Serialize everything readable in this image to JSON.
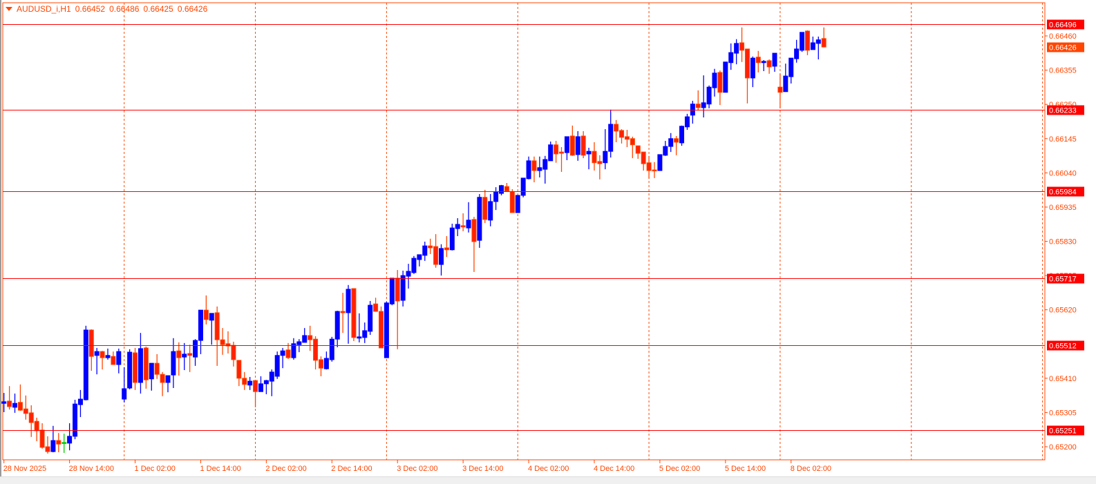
{
  "header": {
    "symbol": "AUDUSD_i,H1",
    "open": "0.66452",
    "high": "0.66486",
    "low": "0.66425",
    "close": "0.66426"
  },
  "colors": {
    "bull": "#0000ff",
    "bear_fill": "#ff2200",
    "bear_outline": "#ff4500",
    "doji_neutral": "#00cc00",
    "level_line": "#ff0000",
    "grid": "#ff4500",
    "axis_text": "#ff4500",
    "ask_label": "#ff4500"
  },
  "chart_data": {
    "type": "candlestick",
    "timeframe": "H1",
    "ylim": [
      0.65165,
      0.666
    ],
    "grid": "vertical dashed, daily",
    "y_ticks": [
      "0.66460",
      "0.66355",
      "0.66250",
      "0.66145",
      "0.66040",
      "0.65935",
      "0.65830",
      "0.65725",
      "0.65620",
      "0.65410",
      "0.65305",
      "0.65200"
    ],
    "x_tick_labels": [
      "28 Nov 2025",
      "28 Nov 14:00",
      "1 Dec 02:00",
      "1 Dec 14:00",
      "2 Dec 02:00",
      "2 Dec 14:00",
      "3 Dec 02:00",
      "3 Dec 14:00",
      "4 Dec 02:00",
      "4 Dec 14:00",
      "5 Dec 02:00",
      "5 Dec 14:00",
      "8 Dec 02:00"
    ],
    "levels": [
      "0.66496",
      "0.66233",
      "0.65984",
      "0.65717",
      "0.65512",
      "0.65251"
    ],
    "current_price": "0.66426",
    "ohlc": [
      [
        0.65333,
        0.65365,
        0.65306,
        0.65338
      ],
      [
        0.6534,
        0.65386,
        0.65314,
        0.65323
      ],
      [
        0.65321,
        0.65363,
        0.65304,
        0.65333
      ],
      [
        0.65336,
        0.65391,
        0.6531,
        0.65312
      ],
      [
        0.65316,
        0.65357,
        0.65283,
        0.65302
      ],
      [
        0.65304,
        0.65327,
        0.6523,
        0.65274
      ],
      [
        0.65278,
        0.65289,
        0.65217,
        0.65249
      ],
      [
        0.65251,
        0.65272,
        0.65194,
        0.65198
      ],
      [
        0.652,
        0.65232,
        0.65179,
        0.65185
      ],
      [
        0.65185,
        0.65264,
        0.65183,
        0.65219
      ],
      [
        0.65219,
        0.65242,
        0.65183,
        0.65208
      ],
      [
        0.65213,
        0.6524,
        0.65181,
        0.65213
      ],
      [
        0.65211,
        0.65272,
        0.65189,
        0.65232
      ],
      [
        0.65232,
        0.65344,
        0.65223,
        0.65331
      ],
      [
        0.65329,
        0.65374,
        0.65291,
        0.65346
      ],
      [
        0.65344,
        0.65571,
        0.65342,
        0.65558
      ],
      [
        0.65558,
        0.6556,
        0.65433,
        0.65477
      ],
      [
        0.6548,
        0.65503,
        0.65422,
        0.65492
      ],
      [
        0.65492,
        0.65494,
        0.65437,
        0.65473
      ],
      [
        0.65473,
        0.65501,
        0.65467,
        0.6548
      ],
      [
        0.65477,
        0.65492,
        0.65452,
        0.65452
      ],
      [
        0.65452,
        0.65501,
        0.65425,
        0.65492
      ],
      [
        0.65346,
        0.65444,
        0.65336,
        0.65378
      ],
      [
        0.6538,
        0.65499,
        0.65376,
        0.6549
      ],
      [
        0.65488,
        0.65503,
        0.65374,
        0.65397
      ],
      [
        0.65397,
        0.65549,
        0.65363,
        0.65501
      ],
      [
        0.65503,
        0.65507,
        0.65378,
        0.65405
      ],
      [
        0.65408,
        0.65456,
        0.65372,
        0.65456
      ],
      [
        0.65456,
        0.65484,
        0.65408,
        0.65422
      ],
      [
        0.65422,
        0.65429,
        0.65355,
        0.65397
      ],
      [
        0.65397,
        0.65418,
        0.65367,
        0.65418
      ],
      [
        0.6542,
        0.65533,
        0.6538,
        0.65492
      ],
      [
        0.65494,
        0.6552,
        0.65418,
        0.65473
      ],
      [
        0.65475,
        0.65518,
        0.65435,
        0.65484
      ],
      [
        0.65486,
        0.65513,
        0.65429,
        0.6548
      ],
      [
        0.65475,
        0.6553,
        0.65448,
        0.65526
      ],
      [
        0.65526,
        0.65619,
        0.65484,
        0.65619
      ],
      [
        0.65619,
        0.65664,
        0.65575,
        0.6559
      ],
      [
        0.65588,
        0.65609,
        0.65513,
        0.65609
      ],
      [
        0.65611,
        0.6563,
        0.65448,
        0.65528
      ],
      [
        0.65528,
        0.65564,
        0.65482,
        0.65513
      ],
      [
        0.65516,
        0.65554,
        0.65486,
        0.65509
      ],
      [
        0.65511,
        0.65522,
        0.65446,
        0.65467
      ],
      [
        0.65465,
        0.65465,
        0.65386,
        0.6541
      ],
      [
        0.6541,
        0.65429,
        0.65374,
        0.65391
      ],
      [
        0.65389,
        0.65414,
        0.65374,
        0.65401
      ],
      [
        0.65403,
        0.65403,
        0.65321,
        0.65369
      ],
      [
        0.65369,
        0.65416,
        0.65369,
        0.65393
      ],
      [
        0.65393,
        0.65405,
        0.65361,
        0.65403
      ],
      [
        0.65401,
        0.65437,
        0.65355,
        0.65429
      ],
      [
        0.65416,
        0.65492,
        0.65408,
        0.6548
      ],
      [
        0.6548,
        0.65503,
        0.65441,
        0.65494
      ],
      [
        0.65497,
        0.65518,
        0.65469,
        0.65473
      ],
      [
        0.65473,
        0.65533,
        0.65467,
        0.65516
      ],
      [
        0.65513,
        0.6553,
        0.6549,
        0.65522
      ],
      [
        0.6552,
        0.65564,
        0.6552,
        0.65541
      ],
      [
        0.65541,
        0.65571,
        0.65494,
        0.65528
      ],
      [
        0.6553,
        0.65539,
        0.65437,
        0.65465
      ],
      [
        0.65467,
        0.65477,
        0.65416,
        0.65441
      ],
      [
        0.65439,
        0.65492,
        0.65437,
        0.65471
      ],
      [
        0.65467,
        0.65537,
        0.65461,
        0.6553
      ],
      [
        0.6553,
        0.65617,
        0.65505,
        0.65615
      ],
      [
        0.65615,
        0.65672,
        0.65549,
        0.65611
      ],
      [
        0.65611,
        0.65696,
        0.65516,
        0.65683
      ],
      [
        0.65685,
        0.65685,
        0.65524,
        0.65535
      ],
      [
        0.65533,
        0.65609,
        0.6552,
        0.65537
      ],
      [
        0.65535,
        0.65581,
        0.65518,
        0.65556
      ],
      [
        0.65554,
        0.65647,
        0.65543,
        0.65634
      ],
      [
        0.65638,
        0.65657,
        0.65615,
        0.65615
      ],
      [
        0.65615,
        0.6563,
        0.65503,
        0.65503
      ],
      [
        0.65473,
        0.65645,
        0.65473,
        0.65641
      ],
      [
        0.65638,
        0.65717,
        0.65634,
        0.65717
      ],
      [
        0.65717,
        0.65742,
        0.65499,
        0.65647
      ],
      [
        0.65649,
        0.6574,
        0.6563,
        0.65725
      ],
      [
        0.65723,
        0.65761,
        0.65685,
        0.65738
      ],
      [
        0.65734,
        0.65785,
        0.6573,
        0.65778
      ],
      [
        0.65774,
        0.65789,
        0.65753,
        0.65789
      ],
      [
        0.65787,
        0.65829,
        0.6577,
        0.65816
      ],
      [
        0.65816,
        0.65838,
        0.65791,
        0.6581
      ],
      [
        0.65814,
        0.65852,
        0.65749,
        0.65759
      ],
      [
        0.65759,
        0.65821,
        0.65725,
        0.65808
      ],
      [
        0.6581,
        0.65846,
        0.65782,
        0.65804
      ],
      [
        0.65804,
        0.65884,
        0.65802,
        0.65871
      ],
      [
        0.65869,
        0.65901,
        0.65846,
        0.65882
      ],
      [
        0.65878,
        0.65916,
        0.65861,
        0.65874
      ],
      [
        0.65871,
        0.6595,
        0.65857,
        0.65895
      ],
      [
        0.65897,
        0.65905,
        0.65736,
        0.65829
      ],
      [
        0.65833,
        0.65975,
        0.6581,
        0.65965
      ],
      [
        0.65965,
        0.65988,
        0.65886,
        0.65897
      ],
      [
        0.65895,
        0.65975,
        0.65876,
        0.65952
      ],
      [
        0.65952,
        0.65996,
        0.65926,
        0.65982
      ],
      [
        0.65977,
        0.66003,
        0.65971,
        0.66001
      ],
      [
        0.65998,
        0.66009,
        0.65982,
        0.65984
      ],
      [
        0.65982,
        0.6599,
        0.65918,
        0.65918
      ],
      [
        0.65918,
        0.65971,
        0.65918,
        0.65971
      ],
      [
        0.65971,
        0.66024,
        0.65965,
        0.66024
      ],
      [
        0.66022,
        0.6609,
        0.6602,
        0.66077
      ],
      [
        0.66077,
        0.6609,
        0.66011,
        0.66047
      ],
      [
        0.66047,
        0.6609,
        0.66026,
        0.66056
      ],
      [
        0.66051,
        0.66092,
        0.66007,
        0.66081
      ],
      [
        0.66077,
        0.66136,
        0.66077,
        0.66126
      ],
      [
        0.66126,
        0.66138,
        0.66071,
        0.66098
      ],
      [
        0.66104,
        0.66119,
        0.66043,
        0.661
      ],
      [
        0.66102,
        0.66151,
        0.66079,
        0.66151
      ],
      [
        0.66153,
        0.66185,
        0.66092,
        0.66094
      ],
      [
        0.66096,
        0.66168,
        0.66077,
        0.66151
      ],
      [
        0.66153,
        0.66168,
        0.66085,
        0.66094
      ],
      [
        0.66098,
        0.66117,
        0.66051,
        0.66106
      ],
      [
        0.66106,
        0.66134,
        0.66047,
        0.66071
      ],
      [
        0.66075,
        0.66094,
        0.6602,
        0.66068
      ],
      [
        0.66071,
        0.66174,
        0.66051,
        0.66106
      ],
      [
        0.66106,
        0.66234,
        0.66087,
        0.66189
      ],
      [
        0.66189,
        0.66202,
        0.66134,
        0.66168
      ],
      [
        0.6617,
        0.66174,
        0.6613,
        0.66149
      ],
      [
        0.66151,
        0.66172,
        0.66119,
        0.66143
      ],
      [
        0.66145,
        0.66151,
        0.66085,
        0.66126
      ],
      [
        0.66123,
        0.66123,
        0.66083,
        0.661
      ],
      [
        0.66104,
        0.66104,
        0.66047,
        0.66068
      ],
      [
        0.66071,
        0.66092,
        0.66022,
        0.66047
      ],
      [
        0.66049,
        0.66073,
        0.66024,
        0.66047
      ],
      [
        0.66047,
        0.66096,
        0.66047,
        0.66096
      ],
      [
        0.66094,
        0.66138,
        0.66092,
        0.66121
      ],
      [
        0.66121,
        0.66162,
        0.66104,
        0.66145
      ],
      [
        0.66145,
        0.66153,
        0.66094,
        0.66134
      ],
      [
        0.66132,
        0.66185,
        0.66123,
        0.66183
      ],
      [
        0.66181,
        0.66221,
        0.66172,
        0.66212
      ],
      [
        0.66217,
        0.66261,
        0.66191,
        0.66251
      ],
      [
        0.66251,
        0.66293,
        0.66231,
        0.6624
      ],
      [
        0.6624,
        0.66339,
        0.6621,
        0.66255
      ],
      [
        0.66251,
        0.66308,
        0.66238,
        0.66303
      ],
      [
        0.66301,
        0.66359,
        0.66274,
        0.66346
      ],
      [
        0.66348,
        0.66354,
        0.66248,
        0.66287
      ],
      [
        0.66287,
        0.6638,
        0.66287,
        0.6638
      ],
      [
        0.66378,
        0.66437,
        0.66356,
        0.66409
      ],
      [
        0.66407,
        0.6645,
        0.66373,
        0.66437
      ],
      [
        0.66439,
        0.66486,
        0.6638,
        0.66416
      ],
      [
        0.6642,
        0.6642,
        0.66253,
        0.66331
      ],
      [
        0.66331,
        0.66397,
        0.66303,
        0.66392
      ],
      [
        0.66395,
        0.66414,
        0.66348,
        0.66378
      ],
      [
        0.66378,
        0.66386,
        0.66352,
        0.66382
      ],
      [
        0.66384,
        0.66388,
        0.66344,
        0.66365
      ],
      [
        0.66367,
        0.66407,
        0.6635,
        0.66407
      ],
      [
        0.66303,
        0.66344,
        0.66238,
        0.66287
      ],
      [
        0.66289,
        0.66375,
        0.66289,
        0.66337
      ],
      [
        0.66335,
        0.66392,
        0.66314,
        0.66392
      ],
      [
        0.6639,
        0.66448,
        0.66378,
        0.6642
      ],
      [
        0.66416,
        0.66471,
        0.66411,
        0.66471
      ],
      [
        0.66475,
        0.66477,
        0.66401,
        0.66416
      ],
      [
        0.66418,
        0.66458,
        0.66418,
        0.66439
      ],
      [
        0.66437,
        0.66458,
        0.66388,
        0.66448
      ],
      [
        0.66452,
        0.66486,
        0.66425,
        0.66426
      ]
    ],
    "neutral_candle_index": 11
  }
}
